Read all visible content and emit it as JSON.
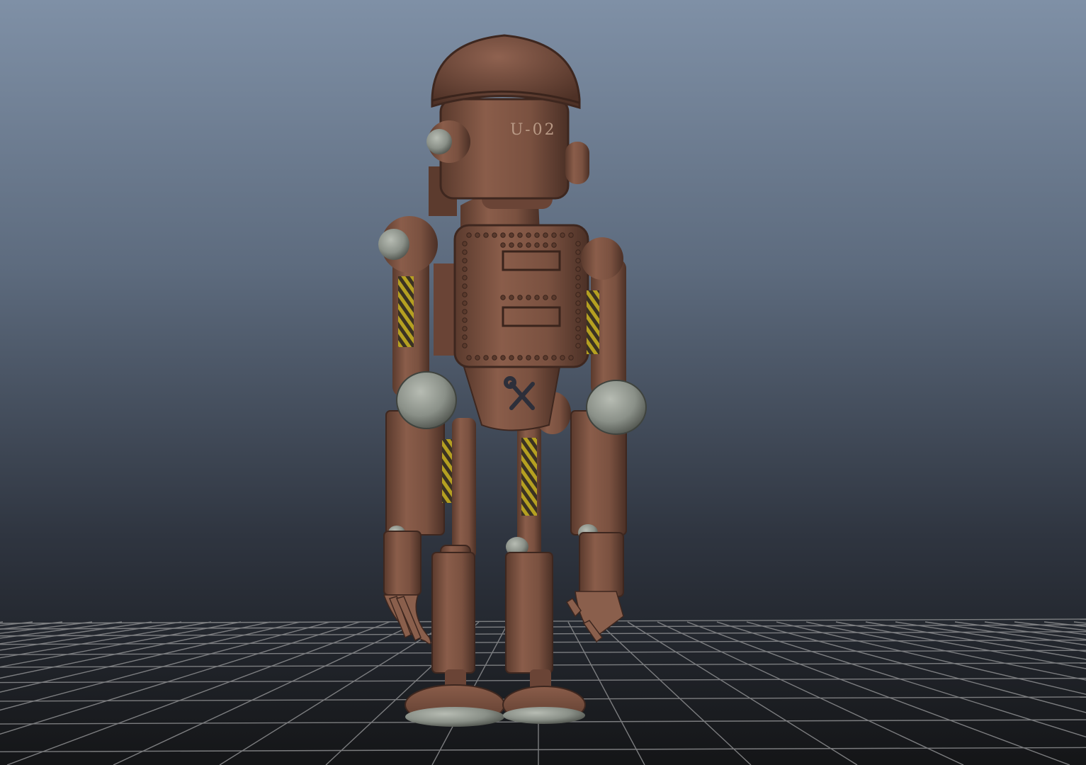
{
  "viewport": {
    "panel": "perspective",
    "background": {
      "top": "#7f90a6",
      "bottom": "#151618"
    },
    "grid_color": "#8d8e90"
  },
  "model": {
    "designation": "U-02",
    "body_color": "#7d5442",
    "joint_color": "#8f958d",
    "hazard_stripe_colors": [
      "#b5a021",
      "#3a3223"
    ],
    "emblem": "wrench-screwdriver-icon"
  }
}
